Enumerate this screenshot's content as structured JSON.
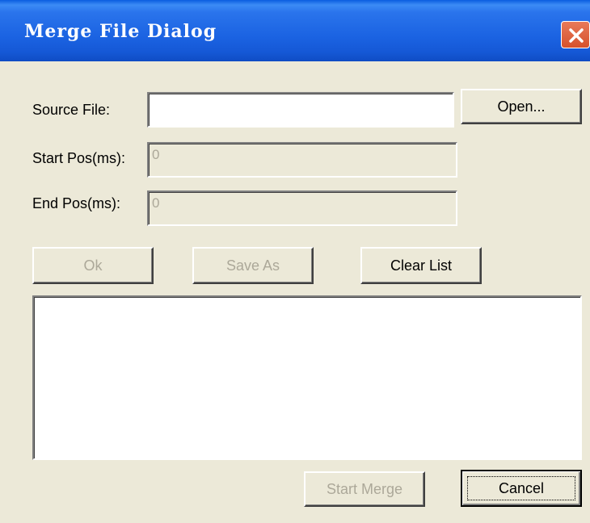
{
  "window": {
    "title": "Merge File Dialog",
    "close_icon": "close-icon"
  },
  "form": {
    "source_label": "Source File:",
    "source_value": "",
    "start_label": "Start Pos(ms):",
    "start_value": "0",
    "end_label": "End Pos(ms):",
    "end_value": "0"
  },
  "buttons": {
    "open": "Open...",
    "ok": "Ok",
    "save_as": "Save As",
    "clear_list": "Clear List",
    "start_merge": "Start Merge",
    "cancel": "Cancel"
  },
  "list": {
    "items": []
  },
  "colors": {
    "dialog_bg": "#ece9d8",
    "titlebar": "#1b63e2",
    "close": "#d6522c",
    "disabled_text": "#aca899"
  }
}
